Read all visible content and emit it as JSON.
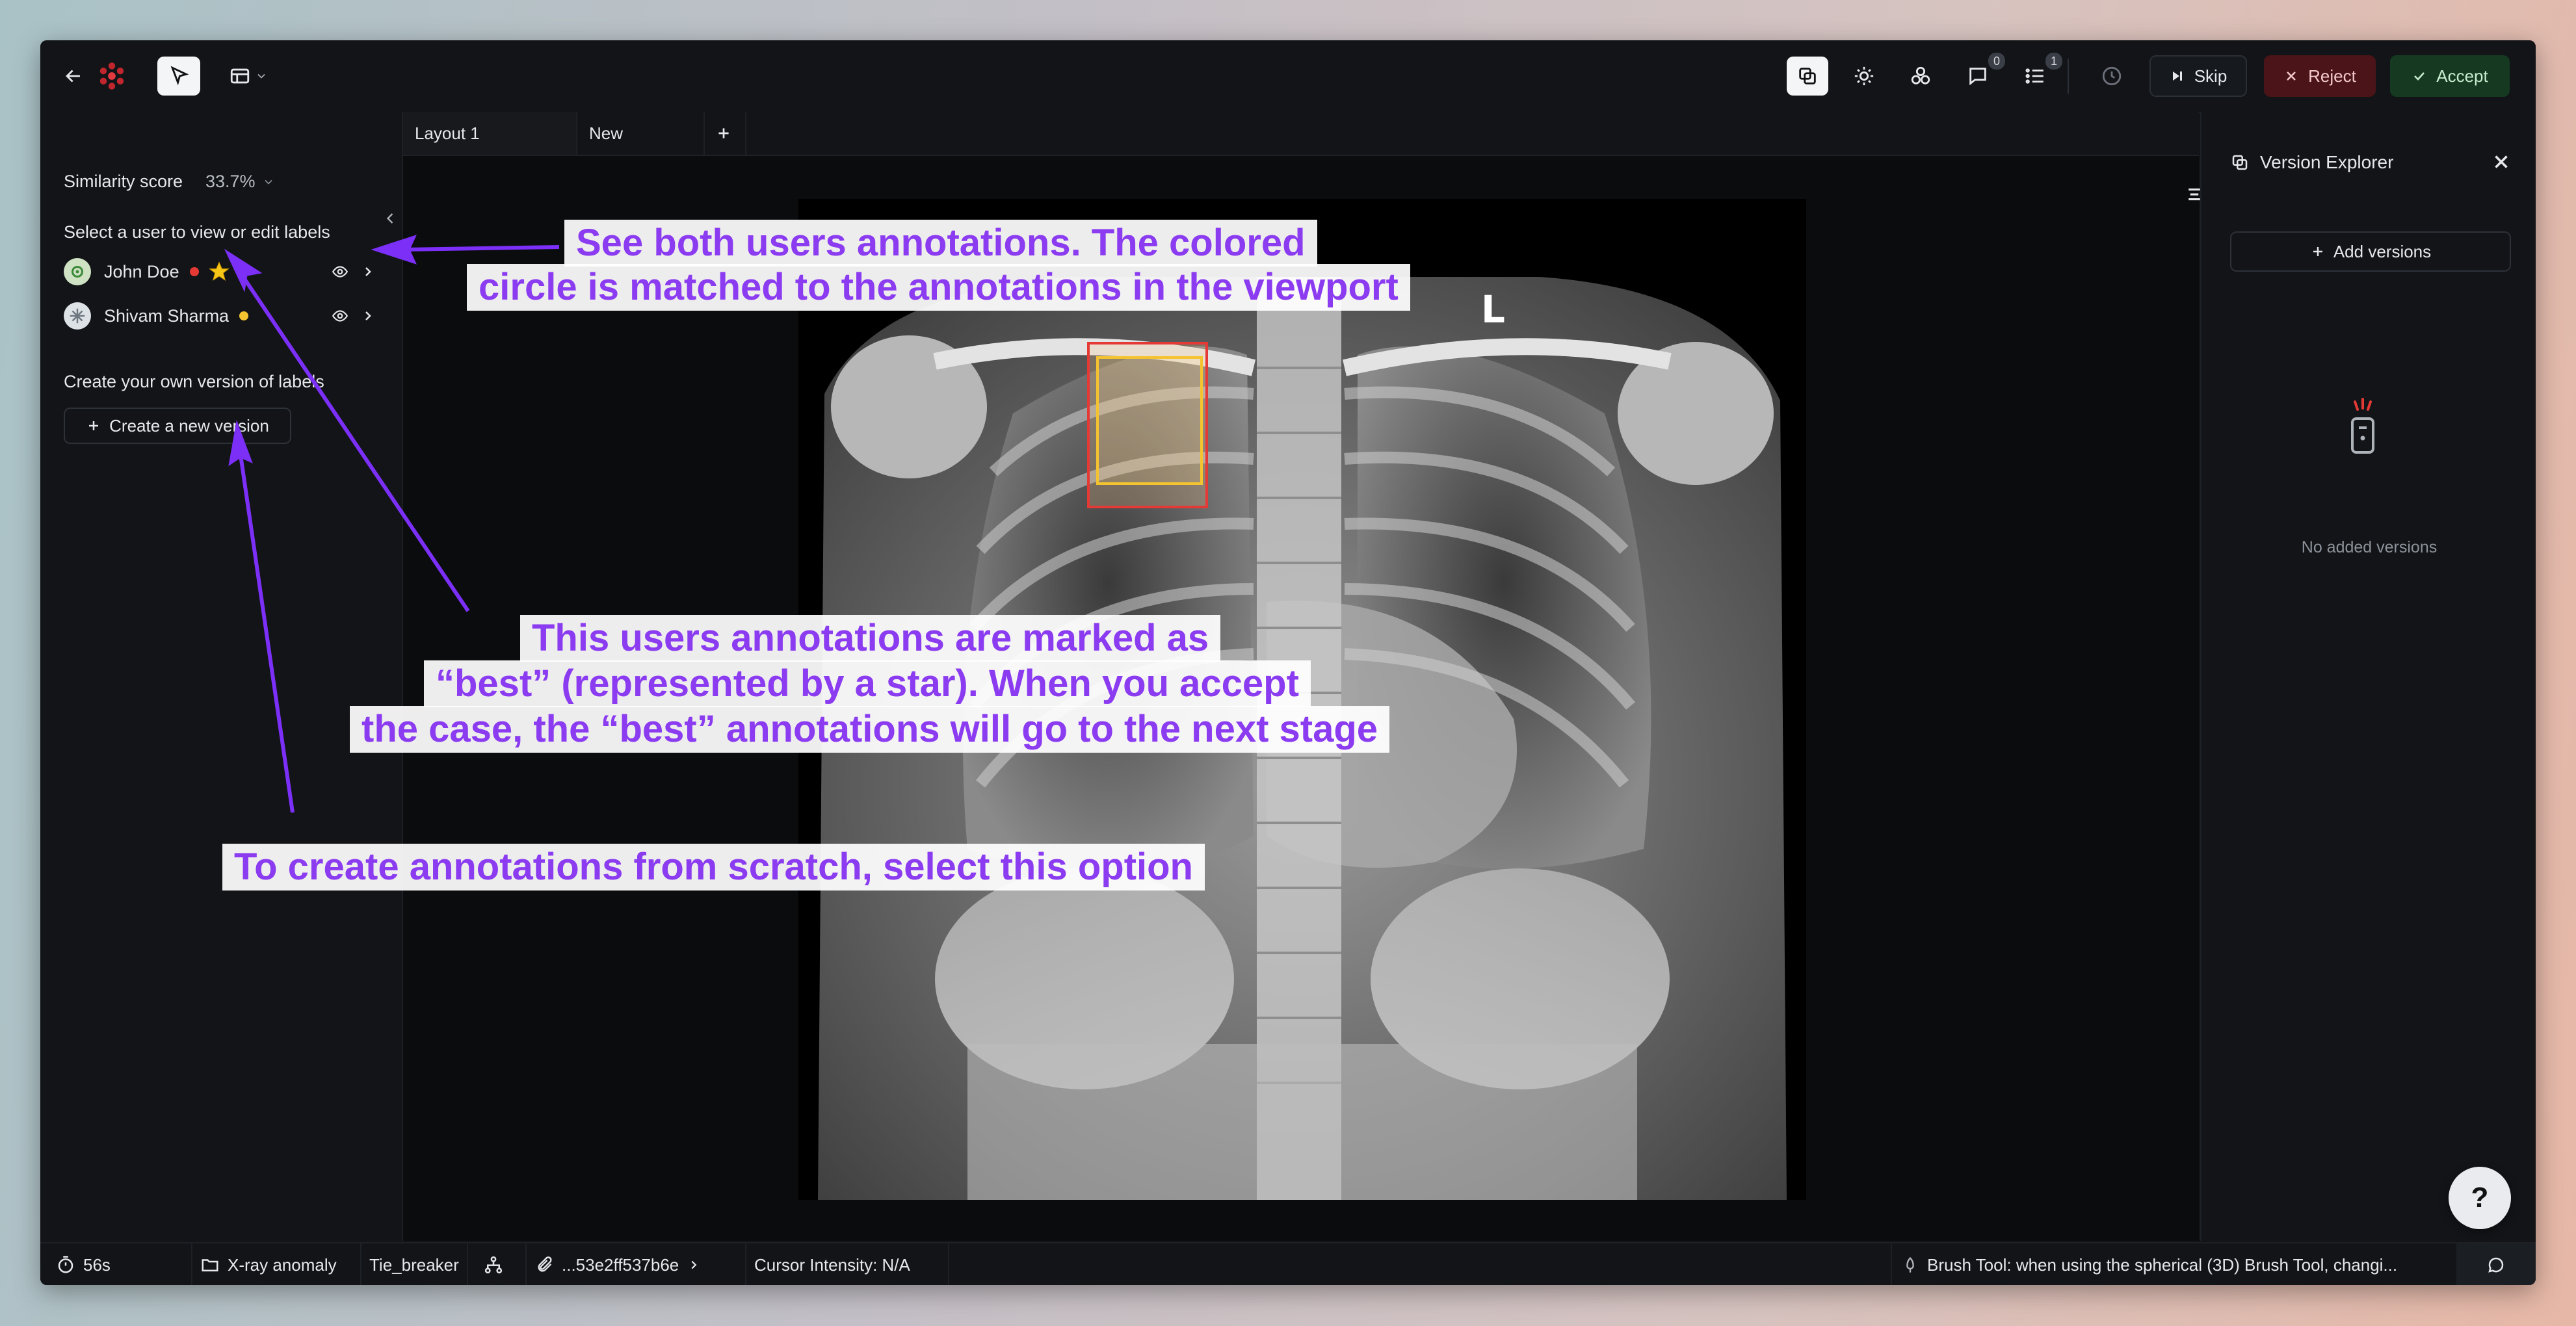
{
  "topbar": {
    "skip_label": "Skip",
    "reject_label": "Reject",
    "accept_label": "Accept",
    "comments_count": "0",
    "tasks_count": "1"
  },
  "left_panel": {
    "similarity_label": "Similarity score",
    "similarity_value": "33.7%",
    "select_user_label": "Select a user to view or edit labels",
    "users": [
      {
        "name": "John Doe",
        "dot_color": "#e53935",
        "best": true
      },
      {
        "name": "Shivam Sharma",
        "dot_color": "#f4c430",
        "best": false
      }
    ],
    "create_own_label": "Create your own version of labels",
    "create_button_label": "Create a new version"
  },
  "tabs": [
    {
      "label": "Layout 1"
    },
    {
      "label": "New"
    }
  ],
  "viewport": {
    "orientation_marker": "L",
    "annotation_colors": {
      "john_doe": "#e53935",
      "shivam_sharma": "#f4c430"
    }
  },
  "right_panel": {
    "title": "Version Explorer",
    "add_versions_label": "Add versions",
    "empty_text": "No added versions"
  },
  "statusbar": {
    "timer": "56s",
    "project": "X-ray anomaly",
    "stage": "Tie_breaker",
    "file_id": "...53e2ff537b6e",
    "cursor_intensity": "Cursor Intensity: N/A",
    "tip": "Brush Tool: when using the spherical (3D) Brush Tool, changi..."
  },
  "help_label": "?",
  "callouts": {
    "viewport_note": [
      "See both users annotations. The colored",
      "circle is matched to the annotations in the viewport"
    ],
    "best_note": [
      "This users annotations are marked as",
      "“best” (represented by a star). When you accept",
      "the case, the “best” annotations will go to the next stage"
    ],
    "scratch_note": "To create annotations from scratch, select this option"
  },
  "colors": {
    "accent_purple": "#8b3bf0",
    "accept_green": "#153a21",
    "reject_red": "#4a1419"
  }
}
